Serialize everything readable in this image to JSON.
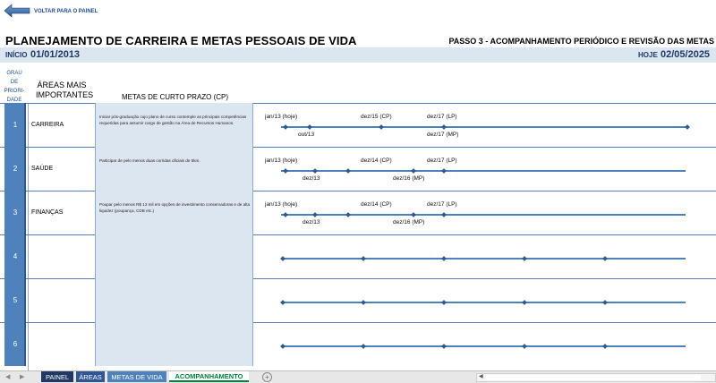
{
  "nav": {
    "back_label": "VOLTAR PARA O PAINEL",
    "back_icon": "arrow-left-icon"
  },
  "header": {
    "title": "PLANEJAMENTO DE CARREIRA E METAS PESSOAIS DE VIDA",
    "step": "PASSO 3 - ACOMPANHAMENTO PERIÓDICO E REVISÃO DAS METAS",
    "inicio_label": "INÍCIO",
    "inicio_value": "01/01/2013",
    "hoje_label": "HOJE",
    "hoje_value": "02/05/2025"
  },
  "columns": {
    "grau": "GRAU DE PRIORI-DADE",
    "areas": "ÁREAS MAIS IMPORTANTES",
    "metas": "METAS DE CURTO PRAZO (CP)"
  },
  "rows": [
    {
      "priority": "1",
      "area": "CARREIRA",
      "goal": "Iniciar pós-graduação cujo plano de curso contemple as principais competências requeridas para assumir cargo de gestão na Área de Recursos Humanos.",
      "labels_top": [
        "jan/13 (hoje)",
        "dez/15 (CP)",
        "dez/17 (LP)"
      ],
      "labels_bottom": [
        "out/13",
        "dez/17 (MP)"
      ]
    },
    {
      "priority": "2",
      "area": "SAÚDE",
      "goal": "Participar de pelo menos duas corridas oficiais de 5km.",
      "labels_top": [
        "jan/13 (hoje)",
        "dez/14 (CP)",
        "dez/17 (LP)"
      ],
      "labels_bottom": [
        "dez/13",
        "dez/16 (MP)"
      ]
    },
    {
      "priority": "3",
      "area": "FINANÇAS",
      "goal": "Poupar pelo menos R$ 12 mil em opções de investimento conservadoras e de alta liquidez (poupança, CDB etc.)",
      "labels_top": [
        "jan/13 (hoje)",
        "dez/14 (CP)",
        "dez/17 (LP)"
      ],
      "labels_bottom": [
        "dez/13",
        "dez/16 (MP)"
      ]
    },
    {
      "priority": "4",
      "area": "",
      "goal": "",
      "labels_top": [],
      "labels_bottom": []
    },
    {
      "priority": "5",
      "area": "",
      "goal": "",
      "labels_top": [],
      "labels_bottom": []
    },
    {
      "priority": "6",
      "area": "",
      "goal": "",
      "labels_top": [],
      "labels_bottom": []
    }
  ],
  "tabs": [
    {
      "label": "PAINEL",
      "color": "#1f3864"
    },
    {
      "label": "ÁREAS",
      "color": "#2f5597"
    },
    {
      "label": "METAS DE VIDA",
      "color": "#4f81bd"
    },
    {
      "label": "ACOMPANHAMENTO",
      "color": "#ffffff",
      "active": true
    }
  ],
  "colors": {
    "accent": "#4f81bd",
    "band": "#dce6f1",
    "tab_active_text": "#00803c"
  }
}
